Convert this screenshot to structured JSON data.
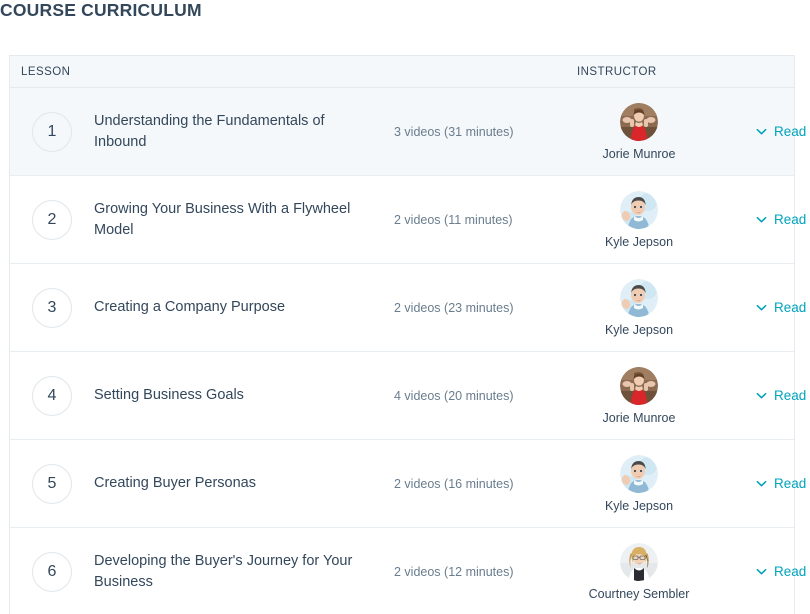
{
  "page_title": "COURSE CURRICULUM",
  "table": {
    "columns": {
      "lesson": "LESSON",
      "instructor": "INSTRUCTOR"
    },
    "read_more_label": "Read more",
    "accent_color": "#00a4bd",
    "text_color": "#33475b",
    "tint_row_color": "#f5f8fa",
    "border_color": "#e5eaef",
    "rows": [
      {
        "number": "1",
        "title": "Understanding the Fundamentals of Inbound",
        "meta": "3 videos (31 minutes)",
        "instructor": "Jorie Munroe",
        "avatar": "jorie",
        "action": "Read more"
      },
      {
        "number": "2",
        "title": "Growing Your Business With a Flywheel Model",
        "meta": "2 videos (11 minutes)",
        "instructor": "Kyle Jepson",
        "avatar": "kyle",
        "action": "Read more"
      },
      {
        "number": "3",
        "title": "Creating a Company Purpose",
        "meta": "2 videos (23 minutes)",
        "instructor": "Kyle Jepson",
        "avatar": "kyle",
        "action": "Read more"
      },
      {
        "number": "4",
        "title": "Setting Business Goals",
        "meta": "4 videos (20 minutes)",
        "instructor": "Jorie Munroe",
        "avatar": "jorie",
        "action": "Read more"
      },
      {
        "number": "5",
        "title": "Creating Buyer Personas",
        "meta": "2 videos (16 minutes)",
        "instructor": "Kyle Jepson",
        "avatar": "kyle",
        "action": "Read more"
      },
      {
        "number": "6",
        "title": "Developing the Buyer's Journey for Your Business",
        "meta": "2 videos (12 minutes)",
        "instructor": "Courtney Sembler",
        "avatar": "courtney",
        "action": "Read more"
      }
    ]
  }
}
